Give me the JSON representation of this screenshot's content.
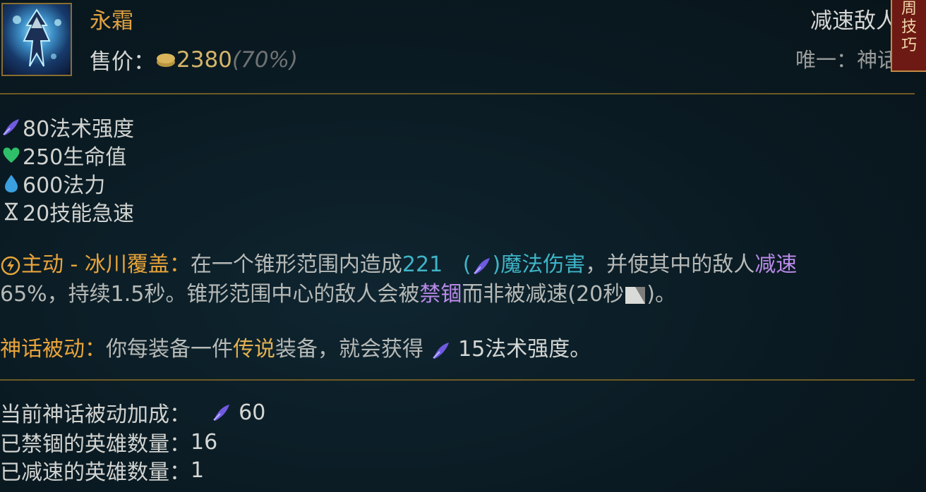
{
  "item": {
    "name": "永霜",
    "price_label": "售价：",
    "price_value": "2380",
    "price_percent": "(70%)",
    "top_right_1": "减速敌人",
    "top_right_2": "唯一：神话",
    "seal_text": [
      "周",
      "技",
      "巧"
    ]
  },
  "stats": [
    {
      "icon": "ability-power-icon",
      "text": "80法术强度"
    },
    {
      "icon": "health-heart-icon",
      "text": "250生命值"
    },
    {
      "icon": "mana-drop-icon",
      "text": "600法力"
    },
    {
      "icon": "ability-haste-hourglass-icon",
      "text": "20技能急速"
    }
  ],
  "active": {
    "label": "主动 - 冰川覆盖：",
    "text_1": "在一个锥形范围内造成",
    "damage": "221",
    "paren_open": "(",
    "paren_close": ")",
    "damage_type": "魔法伤害",
    "text_2": "，并使其中的敌人",
    "slow": "减速",
    "text_3": "65%，持续1.5秒。锥形范围中心的敌人会被",
    "root": "禁锢",
    "text_4": "而非被减速(20秒",
    "text_5": ")。"
  },
  "mythic": {
    "label": "神话被动：",
    "text_1": "你每装备一件",
    "legendary": "传说",
    "text_2": "装备，就会获得",
    "text_3": "15法术强度。"
  },
  "footer": [
    {
      "label": "当前神话被动加成：",
      "value": "60",
      "has_icon": true
    },
    {
      "label": "已禁锢的英雄数量：",
      "value": "16",
      "has_icon": false
    },
    {
      "label": "已减速的英雄数量：",
      "value": "1",
      "has_icon": false
    }
  ],
  "colors": {
    "gold": "#e8a43a",
    "cyan": "#3fb4c7",
    "purple": "#b98ae8",
    "ap_icon": "#6f5ae0",
    "health": "#2fbf6a",
    "mana": "#3aa0e0"
  }
}
